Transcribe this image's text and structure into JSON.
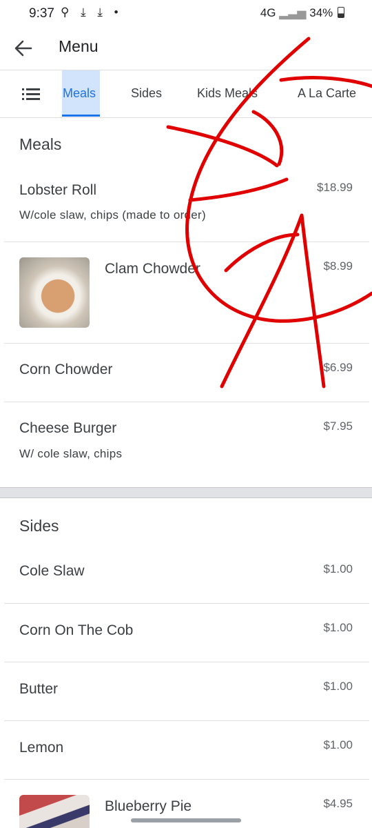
{
  "status": {
    "time": "9:37",
    "left_icons": "⚲ ⤓ ⤓ •",
    "network": "4G",
    "battery": "34%"
  },
  "appbar": {
    "title": "Menu"
  },
  "tabs": [
    {
      "label": "Meals"
    },
    {
      "label": "Sides"
    },
    {
      "label": "Kids Meals"
    },
    {
      "label": "A La Carte"
    }
  ],
  "meals": {
    "title": "Meals",
    "items": [
      {
        "name": "Lobster Roll",
        "desc": "W/cole slaw, chips (made to order)",
        "price": "$18.99"
      },
      {
        "name": "Clam Chowder",
        "price": "$8.99"
      },
      {
        "name": "Corn Chowder",
        "price": "$6.99"
      },
      {
        "name": "Cheese Burger",
        "desc": "W/ cole slaw, chips",
        "price": "$7.95"
      }
    ]
  },
  "sides": {
    "title": "Sides",
    "items": [
      {
        "name": "Cole Slaw",
        "price": "$1.00"
      },
      {
        "name": "Corn On The Cob",
        "price": "$1.00"
      },
      {
        "name": "Butter",
        "price": "$1.00"
      },
      {
        "name": "Lemon",
        "price": "$1.00"
      },
      {
        "name": "Blueberry Pie",
        "price": "$4.95"
      }
    ]
  },
  "colors": {
    "accent": "#1a73e8",
    "tab_highlight": "#d2e3fc",
    "scribble": "#e00000"
  }
}
